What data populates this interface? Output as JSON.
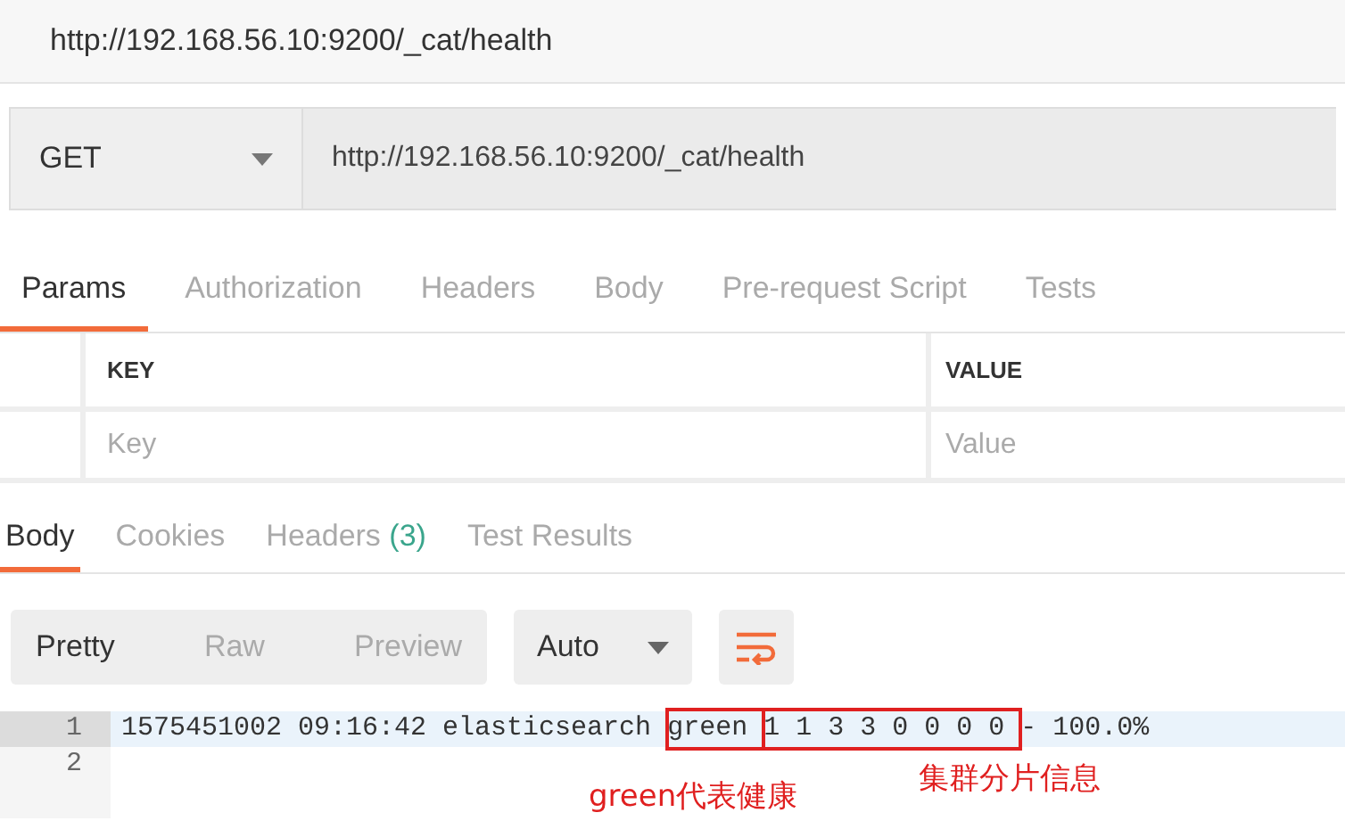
{
  "window": {
    "title": "http://192.168.56.10:9200/_cat/health"
  },
  "request": {
    "method": "GET",
    "url": "http://192.168.56.10:9200/_cat/health"
  },
  "request_tabs": [
    {
      "label": "Params",
      "selected": true
    },
    {
      "label": "Authorization",
      "selected": false
    },
    {
      "label": "Headers",
      "selected": false
    },
    {
      "label": "Body",
      "selected": false
    },
    {
      "label": "Pre-request Script",
      "selected": false
    },
    {
      "label": "Tests",
      "selected": false
    }
  ],
  "params_table": {
    "columns": [
      "KEY",
      "VALUE"
    ],
    "placeholders": [
      "Key",
      "Value"
    ]
  },
  "response_tabs": [
    {
      "label": "Body",
      "selected": true
    },
    {
      "label": "Cookies",
      "selected": false
    },
    {
      "label": "Headers",
      "count": "(3)",
      "selected": false
    },
    {
      "label": "Test Results",
      "selected": false
    }
  ],
  "view_modes": [
    {
      "label": "Pretty",
      "selected": true
    },
    {
      "label": "Raw",
      "selected": false
    },
    {
      "label": "Preview",
      "selected": false
    }
  ],
  "format": "Auto",
  "code_lines": [
    {
      "number": "1",
      "segments": [
        {
          "text": "1575451002 09:16:42 elasticsearch ",
          "boxed": false
        },
        {
          "text": "green ",
          "boxed": true
        },
        {
          "text": "1 1 3 3 0 0 0 0 ",
          "boxed": true
        },
        {
          "text": "- 100.0%",
          "boxed": false
        }
      ]
    },
    {
      "number": "2"
    }
  ],
  "annotations": [
    "green代表健康",
    "集群分片信息"
  ]
}
